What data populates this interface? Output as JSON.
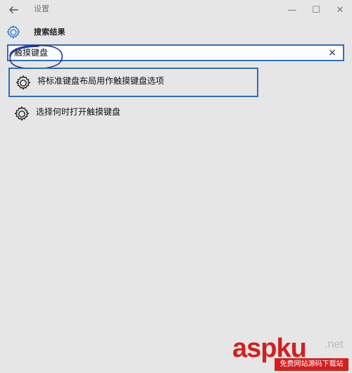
{
  "window": {
    "title": "设置",
    "controls": {
      "minimize": "—",
      "maximize": "☐",
      "close": "✕"
    }
  },
  "page": {
    "title": "搜索结果"
  },
  "search": {
    "value": "触摸键盘",
    "placeholder": "",
    "clear": "×"
  },
  "results": [
    {
      "label": "将标准键盘布局用作触摸键盘选项",
      "icon": "gear-icon",
      "selected": true
    },
    {
      "label": "选择何时打开触摸键盘",
      "icon": "gear-icon",
      "selected": false
    }
  ],
  "watermark": {
    "main": "aspku",
    "suffix": ".net",
    "sub": "免费网站源码下载站"
  },
  "colors": {
    "background": "#e6e6e6",
    "accent": "#2f6fb5",
    "annotation": "#2b2f9a",
    "watermark": "#d31f1f"
  }
}
